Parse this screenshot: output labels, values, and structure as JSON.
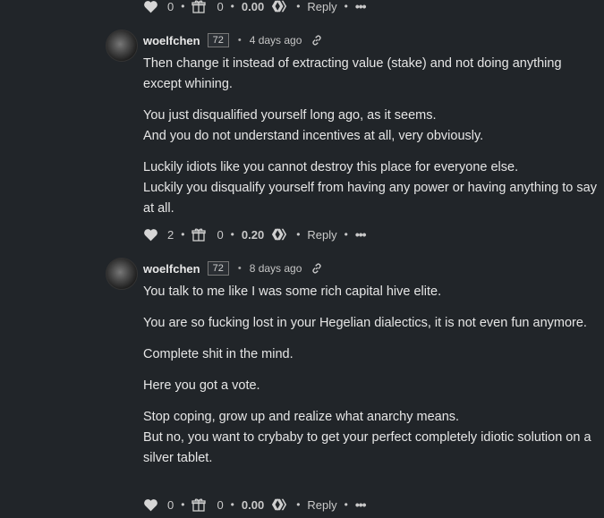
{
  "top_actions": {
    "votes": "0",
    "gifts": "0",
    "payout": "0.00",
    "reply": "Reply",
    "more": "•••"
  },
  "comments": [
    {
      "author": "woelfchen",
      "reputation": "72",
      "time": "4 days ago",
      "paragraphs": [
        "Then change it instead of extracting value (stake) and not doing anything except whining.",
        "You just disqualified yourself long ago, as it seems.",
        "And you do not understand incentives at all, very obviously.",
        "Luckily idiots like you cannot destroy this place for everyone else.",
        "Luckily you disqualify yourself from having any power or having anything to say at all."
      ],
      "actions": {
        "votes": "2",
        "gifts": "0",
        "payout": "0.20",
        "reply": "Reply",
        "more": "•••"
      }
    },
    {
      "author": "woelfchen",
      "reputation": "72",
      "time": "8 days ago",
      "paragraphs": [
        "You talk to me like I was some rich capital hive elite.",
        "You are so fucking lost in your Hegelian dialectics, it is not even fun anymore.",
        "Complete shit in the mind.",
        "Here you got a vote.",
        "Stop coping, grow up and realize what anarchy means.",
        "But no, you want to crybaby to get your perfect completely idiotic solution on a silver tablet."
      ],
      "actions": {
        "votes": "0",
        "gifts": "0",
        "payout": "0.00",
        "reply": "Reply",
        "more": "•••"
      }
    }
  ],
  "colors": {
    "background": "#212529",
    "text": "#e3e3e3",
    "muted": "#c5c5c5"
  }
}
